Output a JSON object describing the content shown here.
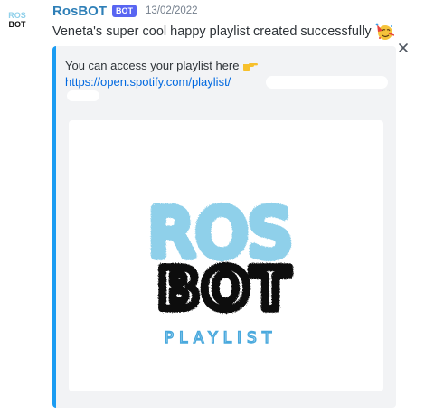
{
  "avatar": {
    "line1": "ROS",
    "line2": "BOT"
  },
  "header": {
    "username": "RosBOT",
    "bot_tag": "BOT",
    "timestamp": "13/02/2022"
  },
  "message": {
    "text": "Veneta's super cool happy playlist created successfully",
    "emoji": "party-face-icon"
  },
  "embed": {
    "accent_color": "#1b9cf2",
    "description": "You can access your playlist here",
    "description_emoji": "pointing-hand-icon",
    "link": "https://open.spotify.com/playlist/",
    "close_icon": "close-icon",
    "image": {
      "line1": "ROS",
      "line2": "BOT",
      "line3": "PLAYLIST"
    }
  },
  "colors": {
    "username": "#2e7fb7",
    "bot_tag_bg": "#5865f2",
    "link": "#0068e0",
    "logo_blue": "#8fd0ea",
    "logo_black": "#111111"
  }
}
